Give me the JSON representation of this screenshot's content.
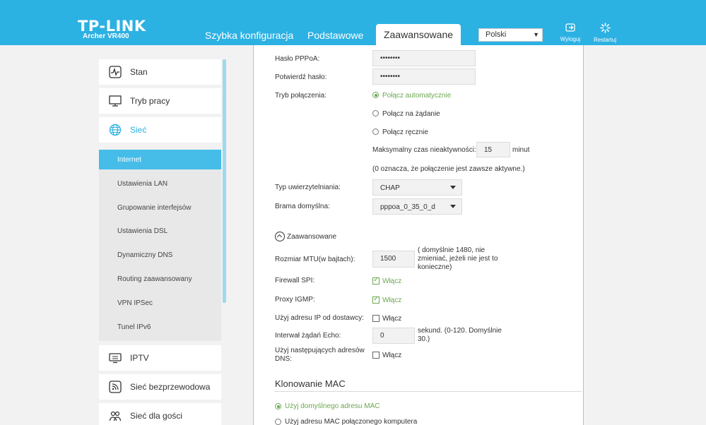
{
  "header": {
    "logo": "TP-LINK",
    "model": "Archer VR400",
    "tabs": [
      "Szybka konfiguracja",
      "Podstawowe",
      "Zaawansowane"
    ],
    "active_tab": "Zaawansowane",
    "language": "Polski",
    "logout_label": "Wyloguj",
    "restart_label": "Restartuj"
  },
  "sidebar": {
    "items": [
      {
        "label": "Stan",
        "icon": "pulse-icon"
      },
      {
        "label": "Tryb pracy",
        "icon": "monitor-icon"
      },
      {
        "label": "Sieć",
        "icon": "globe-icon"
      },
      {
        "label": "IPTV",
        "icon": "tv-icon"
      },
      {
        "label": "Sieć bezprzewodowa",
        "icon": "wireless-icon"
      },
      {
        "label": "Sieć dla gości",
        "icon": "guests-icon"
      }
    ],
    "sub_items": [
      "Internet",
      "Ustawienia LAN",
      "Grupowanie interfejsów",
      "Ustawienia DSL",
      "Dynamiczny DNS",
      "Routing zaawansowany",
      "VPN IPSec",
      "Tunel IPv6"
    ]
  },
  "form": {
    "pppoa_password_label": "Hasło PPPoA:",
    "pppoa_password_value": "••••••••",
    "confirm_password_label": "Potwierdź hasło:",
    "confirm_password_value": "••••••••",
    "connection_mode_label": "Tryb połączenia:",
    "mode_auto": "Połącz automatycznie",
    "mode_demand": "Połącz na żądanie",
    "mode_manual": "Połącz ręcznie",
    "idle_label": "Maksymalny czas nieaktywności:",
    "idle_value": "15",
    "idle_unit": "minut",
    "idle_note": "(0 oznacza, że połączenie jest zawsze aktywne.)",
    "auth_type_label": "Typ uwierzytelniania:",
    "auth_type_value": "CHAP",
    "gateway_label": "Brama domyślna:",
    "gateway_value": "pppoa_0_35_0_d",
    "advanced_label": "Zaawansowane",
    "mtu_label": "Rozmiar MTU(w bajtach):",
    "mtu_value": "1500",
    "mtu_note_1": "( domyślnie 1480, nie",
    "mtu_note_2": "zmieniać, jeżeli nie jest to",
    "mtu_note_3": "konieczne)",
    "firewall_label": "Firewall SPI:",
    "firewall_opt": "Włącz",
    "igmp_label": "Proxy IGMP:",
    "igmp_opt": "Włącz",
    "isp_ip_label": "Użyj adresu IP od dostawcy:",
    "isp_ip_opt": "Włącz",
    "echo_label": "Interwał żądań Echo:",
    "echo_value": "0",
    "echo_note_1": "sekund. (0-120. Domyślnie",
    "echo_note_2": "30.)",
    "dns_label_1": "Użyj następujących adresów",
    "dns_label_2": "DNS:",
    "dns_opt": "Włącz",
    "mac_title": "Klonowanie MAC",
    "mac_default": "Użyj domyślnego adresu MAC",
    "mac_computer": "Użyj adresu MAC połączonego komputera"
  }
}
